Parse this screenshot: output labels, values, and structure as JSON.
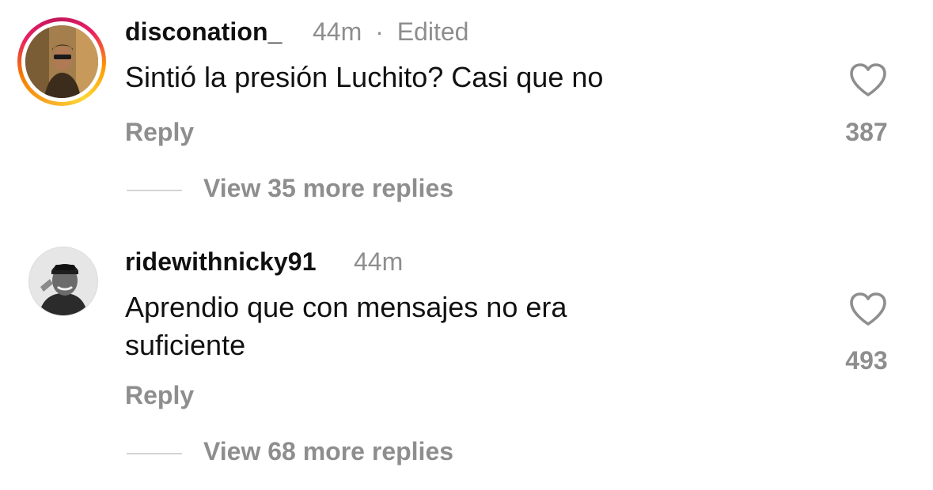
{
  "comments": [
    {
      "username": "disconation_",
      "time": "44m",
      "separator": "·",
      "edited": "Edited",
      "text": "Sintió la presión Luchito? Casi que no",
      "reply_label": "Reply",
      "likes": "387",
      "view_more": "View 35 more replies",
      "avatar_story_ring": true,
      "icon": "heart-icon"
    },
    {
      "username": "ridewithnicky91",
      "time": "44m",
      "text": "Aprendio que con mensajes no era suficiente",
      "reply_label": "Reply",
      "likes": "493",
      "view_more": "View 68 more replies",
      "avatar_story_ring": false,
      "icon": "heart-icon"
    }
  ],
  "colors": {
    "text": "#111111",
    "secondary": "#8e8e8e",
    "divider": "#d4d4d4"
  }
}
